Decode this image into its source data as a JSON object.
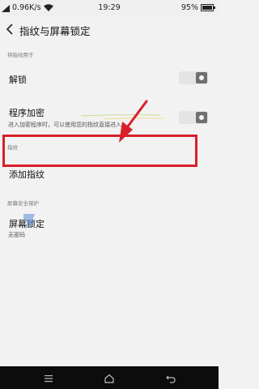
{
  "status_bar": {
    "speed": "0.96K/s",
    "time": "19:29",
    "battery": "95%"
  },
  "header": {
    "title": "指纹与屏幕锁定",
    "back_icon": "back-arrow-icon"
  },
  "sections": {
    "fingerprint_usage": {
      "label": "将指纹用于",
      "unlock": {
        "label": "解锁",
        "enabled": false
      },
      "app_lock": {
        "label": "程序加密",
        "description": "进入加密程序时，可以使用您的指纹直接进入。",
        "enabled": false
      }
    },
    "fingerprint": {
      "label": "指纹",
      "add_fingerprint": {
        "label": "添加指纹"
      }
    },
    "screen_security": {
      "label": "屏幕安全保护",
      "screen_lock": {
        "label": "屏幕锁定",
        "value": "无密码"
      }
    }
  },
  "annotation": {
    "highlight_color": "#d9202a"
  },
  "nav_bar": {
    "icons": [
      "menu-icon",
      "home-icon",
      "back-icon"
    ]
  }
}
